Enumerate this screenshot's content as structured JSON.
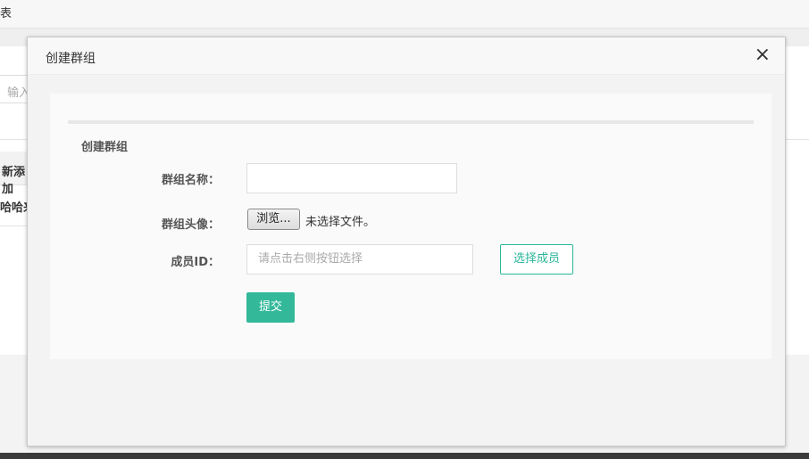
{
  "background": {
    "topbar_text": "表",
    "search_placeholder": "输入",
    "list_rows": [
      "新添加",
      "哈哈来"
    ]
  },
  "modal": {
    "title": "创建群组",
    "close_symbol": "×",
    "section_title": "创建群组",
    "fields": {
      "group_name_label": "群组名称：",
      "group_avatar_label": "群组头像：",
      "member_id_label": "成员ID：",
      "group_name_value": "",
      "file_button_label": "浏览...",
      "file_status": "未选择文件。",
      "member_placeholder": "请点击右侧按钮选择"
    },
    "select_members_label": "选择成员",
    "submit_label": "提交"
  },
  "colors": {
    "accent": "#33b89a",
    "accent_border": "#2ab69a"
  }
}
